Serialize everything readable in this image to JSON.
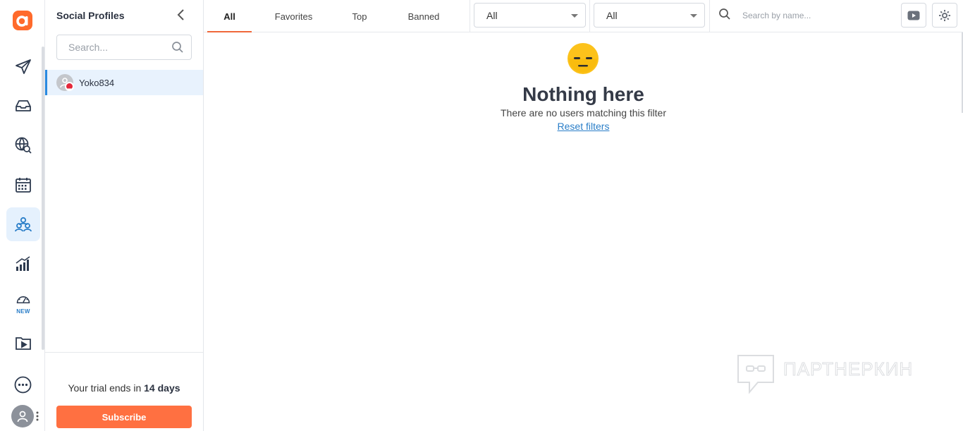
{
  "sidebar": {
    "profiles_title": "Social Profiles",
    "search_placeholder": "Search...",
    "profiles": [
      {
        "name": "Yoko834",
        "status_badge": "blocked"
      }
    ],
    "trial_prefix": "Your trial ends in ",
    "trial_days": "14 days",
    "subscribe_label": "Subscribe"
  },
  "rail": {
    "items": [
      "publish",
      "inbox",
      "listening",
      "calendar",
      "audience",
      "analytics",
      "speedometer",
      "media"
    ],
    "active_item": "audience",
    "new_tag": "NEW"
  },
  "main": {
    "tabs": [
      {
        "label": "All",
        "active": true
      },
      {
        "label": "Favorites",
        "active": false
      },
      {
        "label": "Top",
        "active": false
      },
      {
        "label": "Banned",
        "active": false
      }
    ],
    "filter1": "All",
    "filter2": "All",
    "search_placeholder": "Search by name...",
    "empty_title": "Nothing here",
    "empty_text": "There are no users matching this filter",
    "reset_label": "Reset filters"
  },
  "watermark": "ПАРТНЕРКИН",
  "colors": {
    "brand": "#ff7041",
    "accent_blue": "#2a7ec8",
    "active_bg": "#e5f1fd",
    "tab_underline": "#f0683a",
    "badge_red": "#e4283b"
  }
}
